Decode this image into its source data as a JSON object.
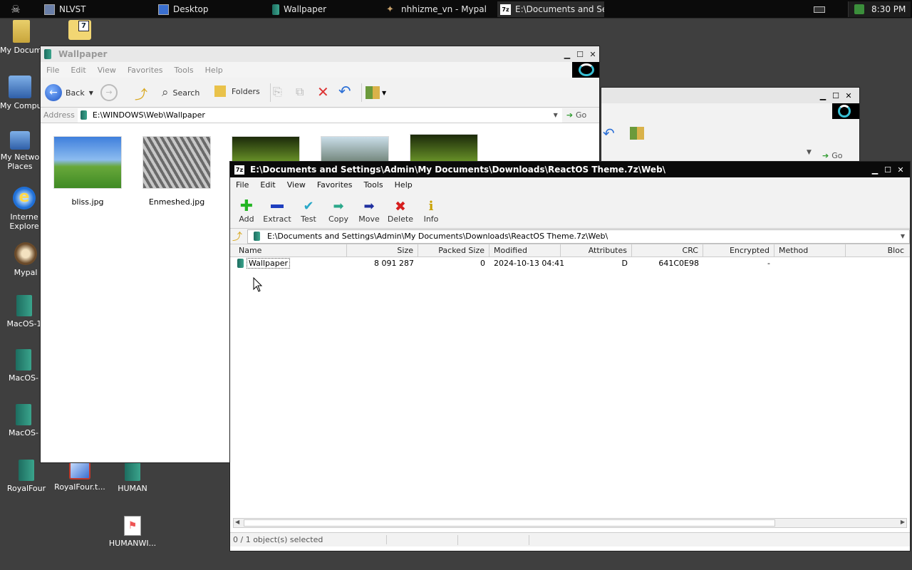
{
  "taskbar": {
    "items": [
      {
        "label": "NLVST"
      },
      {
        "label": "Desktop"
      },
      {
        "label": "Wallpaper"
      },
      {
        "label": "nhhizme_vn - Mypal"
      },
      {
        "label": "E:\\Documents and Se..."
      }
    ],
    "clock": "8:30 PM"
  },
  "desktop": {
    "icons": [
      {
        "label": "My Docume"
      },
      {
        "label": "My Compu"
      },
      {
        "label": "My Netwo Places"
      },
      {
        "label": "Interne Explore"
      },
      {
        "label": "Mypal"
      },
      {
        "label": "MacOS-1"
      },
      {
        "label": "MacOS-"
      },
      {
        "label": "MacOS-"
      },
      {
        "label": "RoyalFour"
      },
      {
        "label": "RoyalFour.t..."
      },
      {
        "label": "HUMAN"
      },
      {
        "label": "HUMANWI..."
      }
    ]
  },
  "explorer": {
    "title": "Wallpaper",
    "menu": [
      "File",
      "Edit",
      "View",
      "Favorites",
      "Tools",
      "Help"
    ],
    "toolbar": {
      "back": "Back",
      "search": "Search",
      "folders": "Folders"
    },
    "address_label": "Address",
    "address": "E:\\WINDOWS\\Web\\Wallpaper",
    "go": "Go",
    "files": [
      {
        "name": "bliss.jpg"
      },
      {
        "name": "Enmeshed.jpg"
      }
    ]
  },
  "zip": {
    "title": "E:\\Documents and Settings\\Admin\\My Documents\\Downloads\\ReactOS Theme.7z\\Web\\",
    "menu": [
      "File",
      "Edit",
      "View",
      "Favorites",
      "Tools",
      "Help"
    ],
    "toolbar": [
      "Add",
      "Extract",
      "Test",
      "Copy",
      "Move",
      "Delete",
      "Info"
    ],
    "path": "E:\\Documents and Settings\\Admin\\My Documents\\Downloads\\ReactOS Theme.7z\\Web\\",
    "columns": [
      "Name",
      "Size",
      "Packed Size",
      "Modified",
      "Attributes",
      "CRC",
      "Encrypted",
      "Method",
      "Bloc"
    ],
    "rows": [
      {
        "name": "Wallpaper",
        "size": "8 091 287",
        "packed": "0",
        "modified": "2024-10-13 04:41",
        "attributes": "D",
        "crc": "641C0E98",
        "encrypted": "-"
      }
    ],
    "status": "0 / 1 object(s) selected"
  },
  "background_window": {
    "go": "Go"
  }
}
